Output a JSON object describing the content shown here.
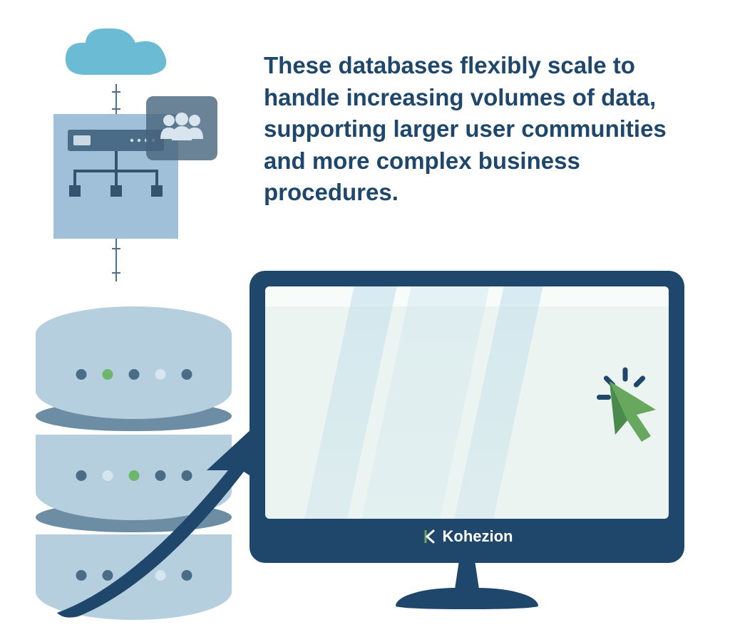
{
  "headline": "These databases flexibly scale to handle increasing volumes of data, supporting larger user communities and more complex business procedures.",
  "brand": {
    "name": "Kohezion"
  },
  "colors": {
    "navy": "#1f476b",
    "cloud": "#6bbbd4",
    "panel": "#9fc0d8",
    "db": "#b6cfdf",
    "dbBand": "#6c8da4",
    "cursor": "#68a75e",
    "cursorDark": "#4a8a4e"
  },
  "icons": {
    "cloud": "cloud-icon",
    "people": "people-icon",
    "network": "network-icon",
    "database": "database-stack-icon",
    "arrow": "growth-arrow-icon",
    "cursor": "click-cursor-icon",
    "brandMark": "kohezion-logo-icon"
  }
}
